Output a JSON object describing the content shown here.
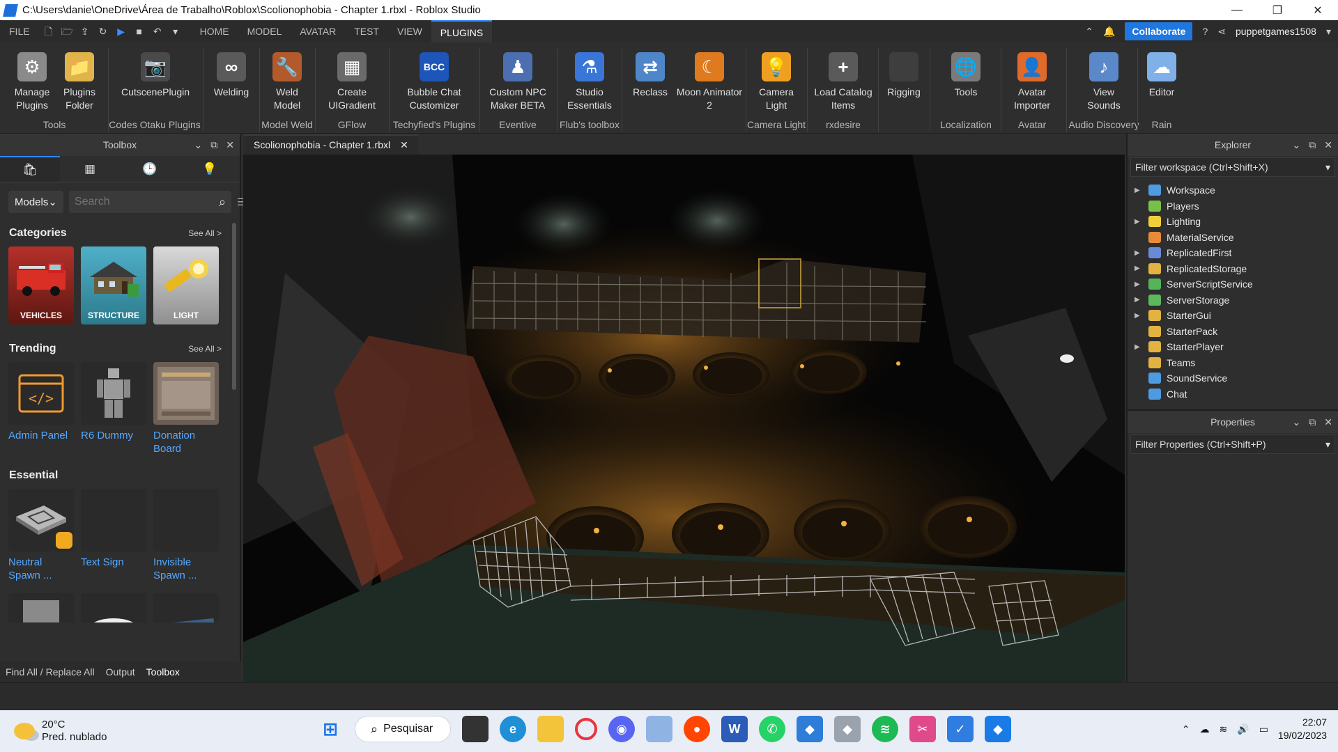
{
  "window": {
    "title": "C:\\Users\\danie\\OneDrive\\Área de Trabalho\\Roblox\\Scolionophobia - Chapter 1.rbxl - Roblox Studio"
  },
  "menu": {
    "items": [
      "FILE",
      "HOME",
      "MODEL",
      "AVATAR",
      "TEST",
      "VIEW",
      "PLUGINS"
    ],
    "active": "PLUGINS",
    "collaborate": "Collaborate",
    "user": "puppetgames1508"
  },
  "ribbon": {
    "buttons": [
      {
        "label": "Manage\nPlugins",
        "icon": "manage-plugins-icon",
        "color": "#8a8a8a",
        "glyph": "⚙"
      },
      {
        "label": "Plugins\nFolder",
        "icon": "plugins-folder-icon",
        "color": "#e0b34b",
        "glyph": "📁"
      },
      {
        "label": "CutscenePlugin",
        "icon": "camera-icon",
        "color": "#4a4a4a",
        "glyph": "📷"
      },
      {
        "label": "Welding",
        "icon": "welding-icon",
        "color": "#5a5a5a",
        "glyph": "∞"
      },
      {
        "label": "Weld\nModel",
        "icon": "weld-model-icon",
        "color": "#b35a2c",
        "glyph": "🔧"
      },
      {
        "label": "Create\nUIGradient",
        "icon": "gradient-icon",
        "color": "#6a6a6a",
        "glyph": "▦"
      },
      {
        "label": "Bubble Chat\nCustomizer",
        "icon": "bubble-chat-icon",
        "color": "#1d55b8",
        "glyph": "BCC"
      },
      {
        "label": "Custom NPC\nMaker BETA",
        "icon": "npc-icon",
        "color": "#4b6fb0",
        "glyph": "♟"
      },
      {
        "label": "Studio\nEssentials",
        "icon": "flask-icon",
        "color": "#3a76d8",
        "glyph": "⚗"
      },
      {
        "label": "Reclass",
        "icon": "reclass-icon",
        "color": "#4e86c9",
        "glyph": "⇄"
      },
      {
        "label": "Moon Animator\n2",
        "icon": "moon-icon",
        "color": "#e07a1f",
        "glyph": "☾"
      },
      {
        "label": "Camera\nLight",
        "icon": "bulb-icon",
        "color": "#f0a020",
        "glyph": "💡"
      },
      {
        "label": "Load Catalog\nItems",
        "icon": "plus-icon",
        "color": "#5a5a5a",
        "glyph": "+"
      },
      {
        "label": "Rigging",
        "icon": "rigging-icon",
        "color": "#3e3e3e",
        "glyph": ""
      },
      {
        "label": "Tools",
        "icon": "globe-tools-icon",
        "color": "#7a7a7a",
        "glyph": "🌐"
      },
      {
        "label": "Avatar\nImporter",
        "icon": "avatar-importer-icon",
        "color": "#e06a2a",
        "glyph": "👤"
      },
      {
        "label": "View\nSounds",
        "icon": "sounds-icon",
        "color": "#5b88c9",
        "glyph": "♪"
      },
      {
        "label": "Editor",
        "icon": "cloud-icon",
        "color": "#7fb0e8",
        "glyph": "☁"
      }
    ],
    "groups": [
      "Tools",
      "Codes Otaku Plugins",
      "Model Weld",
      "GFlow",
      "Techyfied's Plugins",
      "Eventive",
      "Flub's toolbox",
      "Camera Light",
      "rxdesire",
      "Localization",
      "Avatar",
      "Audio Discovery",
      "Rain"
    ]
  },
  "toolbox": {
    "title": "Toolbox",
    "dropdown": "Models",
    "search_placeholder": "Search",
    "categories_title": "Categories",
    "see_all": "See All >",
    "categories": [
      "VEHICLES",
      "STRUCTURE",
      "LIGHT"
    ],
    "trending_title": "Trending",
    "trending": [
      "Admin Panel",
      "R6 Dummy",
      "Donation Board"
    ],
    "essential_title": "Essential",
    "essential": [
      "Neutral Spawn ...",
      "Text Sign",
      "Invisible Spawn ..."
    ],
    "bottom_tabs": [
      "Find All / Replace All",
      "Output",
      "Toolbox"
    ]
  },
  "document": {
    "tab": "Scolionophobia - Chapter 1.rbxl"
  },
  "explorer": {
    "title": "Explorer",
    "filter": "Filter workspace (Ctrl+Shift+X)",
    "nodes": [
      {
        "name": "Workspace",
        "expand": true,
        "color": "#4f9be0"
      },
      {
        "name": "Players",
        "expand": false,
        "color": "#78c04a"
      },
      {
        "name": "Lighting",
        "expand": true,
        "color": "#f2cf3a"
      },
      {
        "name": "MaterialService",
        "expand": false,
        "color": "#e98a3a"
      },
      {
        "name": "ReplicatedFirst",
        "expand": true,
        "color": "#6a8ad8"
      },
      {
        "name": "ReplicatedStorage",
        "expand": true,
        "color": "#e3b341"
      },
      {
        "name": "ServerScriptService",
        "expand": true,
        "color": "#55b35a"
      },
      {
        "name": "ServerStorage",
        "expand": true,
        "color": "#5cb85c"
      },
      {
        "name": "StarterGui",
        "expand": true,
        "color": "#e3b341"
      },
      {
        "name": "StarterPack",
        "expand": false,
        "color": "#e3b341"
      },
      {
        "name": "StarterPlayer",
        "expand": true,
        "color": "#e3b341"
      },
      {
        "name": "Teams",
        "expand": false,
        "color": "#e3b341"
      },
      {
        "name": "SoundService",
        "expand": false,
        "color": "#4f9be0"
      },
      {
        "name": "Chat",
        "expand": false,
        "color": "#4f9be0"
      }
    ]
  },
  "properties": {
    "title": "Properties",
    "filter": "Filter Properties (Ctrl+Shift+P)"
  },
  "taskbar": {
    "temp": "20°C",
    "weather": "Pred. nublado",
    "search": "Pesquisar",
    "time": "22:07",
    "date": "19/02/2023"
  }
}
